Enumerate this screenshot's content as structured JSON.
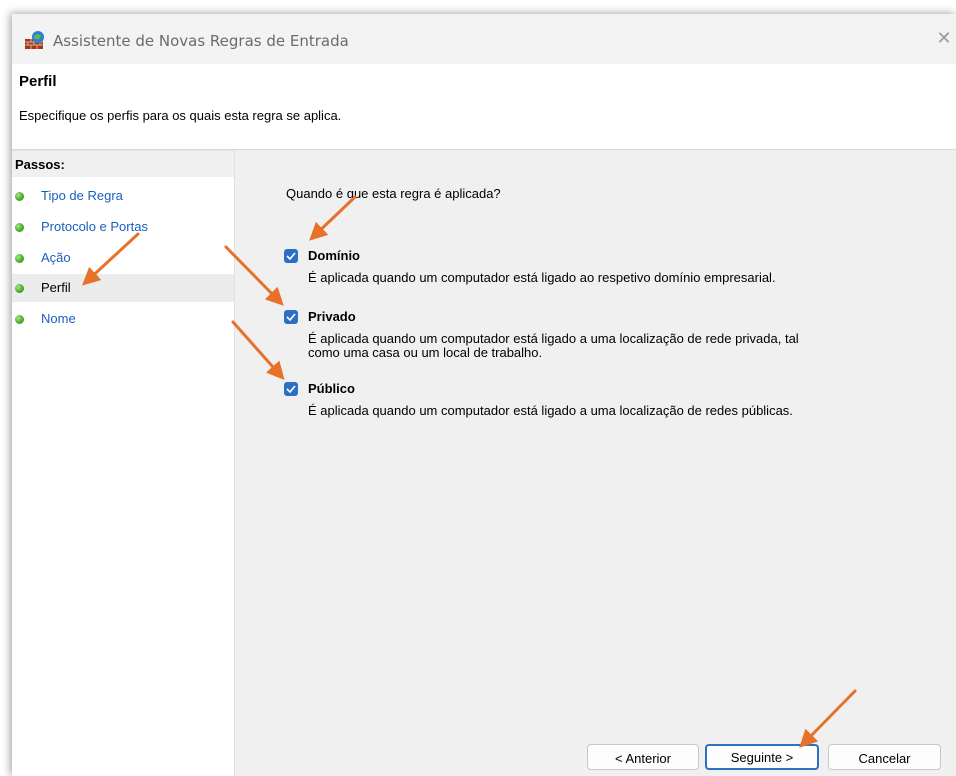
{
  "window": {
    "title": "Assistente de Novas Regras de Entrada",
    "close_glyph": "✕"
  },
  "header": {
    "title": "Perfil",
    "subtitle": "Especifique os perfis para os quais esta regra se aplica."
  },
  "sidebar": {
    "heading": "Passos:",
    "steps": [
      {
        "label": "Tipo de Regra",
        "current": false
      },
      {
        "label": "Protocolo e Portas",
        "current": false
      },
      {
        "label": "Ação",
        "current": false
      },
      {
        "label": "Perfil",
        "current": true
      },
      {
        "label": "Nome",
        "current": false
      }
    ]
  },
  "main": {
    "question": "Quando é que esta regra é aplicada?",
    "options": [
      {
        "label": "Domínio",
        "checked": true,
        "description": "É aplicada quando um computador está ligado ao respetivo domínio empresarial."
      },
      {
        "label": "Privado",
        "checked": true,
        "description_line1": "É aplicada quando um computador está ligado a uma localização de rede privada, tal",
        "description_line2": "como uma casa ou um local de trabalho."
      },
      {
        "label": "Público",
        "checked": true,
        "description": "É aplicada quando um computador está ligado a uma localização de redes públicas."
      }
    ]
  },
  "buttons": {
    "back": "< Anterior",
    "next": "Seguinte >",
    "cancel": "Cancelar"
  },
  "colors": {
    "accent": "#2d6fc2",
    "annotation_arrow": "#e8712a",
    "step_link": "#1a5fbf"
  },
  "icons": {
    "app": "firewall-icon",
    "close": "close-icon",
    "step_bullet": "green-dot-icon",
    "check": "checkmark-icon"
  }
}
